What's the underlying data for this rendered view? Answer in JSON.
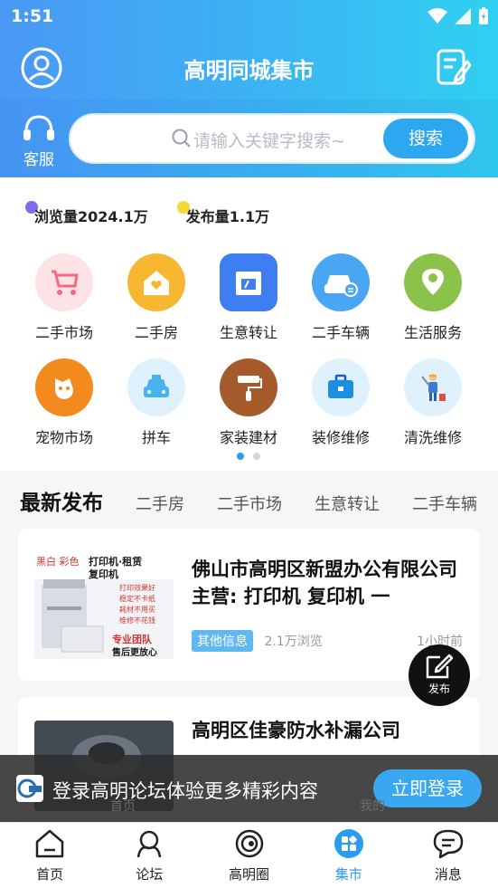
{
  "status_bar": {
    "time": "1:51"
  },
  "header": {
    "title": "高明同城集市",
    "customer_service_label": "客服",
    "search_placeholder": "请输入关键字搜索~",
    "search_button": "搜索"
  },
  "stats": {
    "views": "浏览量2024.1万",
    "posts": "发布量1.1万"
  },
  "categories": [
    {
      "label": "二手市场",
      "icon": "stroller-icon",
      "color": "#f87d8f"
    },
    {
      "label": "二手房",
      "icon": "house-heart-icon",
      "color": "#f7b731"
    },
    {
      "label": "生意转让",
      "icon": "shop-icon",
      "color": "#3f7ef0"
    },
    {
      "label": "二手车辆",
      "icon": "car-icon",
      "color": "#4aa6f2"
    },
    {
      "label": "生活服务",
      "icon": "location-pin-icon",
      "color": "#8bc34a"
    },
    {
      "label": "宠物市场",
      "icon": "dog-icon",
      "color": "#f28a1e"
    },
    {
      "label": "拼车",
      "icon": "taxi-icon",
      "color": "#48b4ef"
    },
    {
      "label": "家装建材",
      "icon": "paint-roller-icon",
      "color": "#a45a2a"
    },
    {
      "label": "装修维修",
      "icon": "toolbox-icon",
      "color": "#1e8fe0"
    },
    {
      "label": "清洗维修",
      "icon": "cleaner-icon",
      "color": "#5fb8ef"
    }
  ],
  "pagination": {
    "pages": 2,
    "current": 1
  },
  "tabs": {
    "main": "最新发布",
    "items": [
      "二手房",
      "二手市场",
      "生意转让",
      "二手车辆"
    ]
  },
  "posts": [
    {
      "title": "佛山市高明区新盟办公有限公司 主营: 打印机 复印机 一",
      "tag": "其他信息",
      "views": "2.1万浏览",
      "time": "1小时前",
      "thumb_text": [
        "黑白 彩色",
        "打印机·租赁",
        "复印机",
        "打印效果好",
        "稳定不卡纸",
        "耗材不用买",
        "维修不花钱",
        "专业团队",
        "售后更放心"
      ]
    },
    {
      "title": "高明区佳豪防水补漏公司"
    }
  ],
  "fab": {
    "label": "发布"
  },
  "login_banner": {
    "text": "登录高明论坛体验更多精彩内容",
    "button": "立即登录",
    "ghost_home": "首页",
    "ghost_mine": "我的"
  },
  "bottom_nav": [
    {
      "label": "首页",
      "icon": "home-icon"
    },
    {
      "label": "论坛",
      "icon": "forum-icon"
    },
    {
      "label": "高明圈",
      "icon": "circle-icon"
    },
    {
      "label": "集市",
      "icon": "market-icon",
      "active": true
    },
    {
      "label": "消息",
      "icon": "message-icon"
    }
  ]
}
